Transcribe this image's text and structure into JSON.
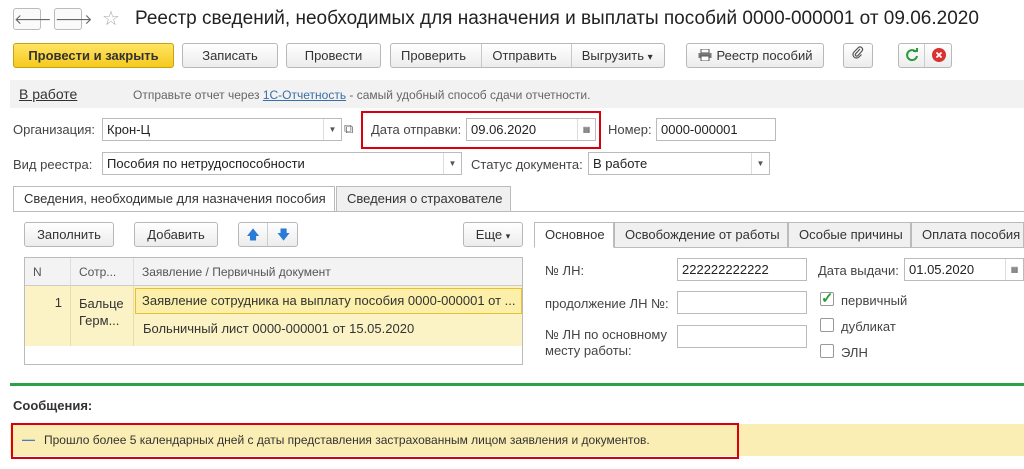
{
  "header": {
    "back": "🡐",
    "forward": "🡒",
    "star": "☆",
    "title": "Реестр сведений, необходимых для назначения и выплаты пособий 0000-000001 от 09.06.2020"
  },
  "toolbar": {
    "post_close": "Провести и закрыть",
    "save": "Записать",
    "post": "Провести",
    "check": "Проверить",
    "send": "Отправить",
    "export": "Выгрузить",
    "export_arrow": "▾",
    "registry": "Реестр пособий",
    "clip_icon": "paperclip-icon",
    "refresh_icon": "refresh-icon",
    "close_icon": "close-icon"
  },
  "status": {
    "state": "В работе",
    "message_prefix": "Отправьте отчет через ",
    "message_link": "1С-Отчетность",
    "message_suffix": " - самый удобный способ сдачи отчетности."
  },
  "form": {
    "org_label": "Организация:",
    "org_value": "Крон-Ц",
    "date_label": "Дата отправки:",
    "date_value": "09.06.2020",
    "number_label": "Номер:",
    "number_value": "0000-000001",
    "registry_label": "Вид реестра:",
    "registry_value": "Пособия по нетрудоспособности",
    "docstatus_label": "Статус документа:",
    "docstatus_value": "В работе"
  },
  "tabs": [
    "Сведения, необходимые для назначения пособия",
    "Сведения о страхователе"
  ],
  "left_toolbar": {
    "fill": "Заполнить",
    "add": "Добавить",
    "more": "Еще"
  },
  "table": {
    "headers": [
      "N",
      "Сотр...",
      "Заявление / Первичный документ"
    ],
    "row": {
      "n": "1",
      "employee": "Бальце Герм...",
      "doc1": "Заявление сотрудника на выплату пособия 0000-000001 от ...",
      "doc2": "Больничный лист 0000-000001 от 15.05.2020"
    }
  },
  "right_tabs": [
    "Основное",
    "Освобождение от работы",
    "Особые причины",
    "Оплата пособия"
  ],
  "details": {
    "ln_label": "№ ЛН:",
    "ln_value": "222222222222",
    "issue_label": "Дата выдачи:",
    "issue_value": "01.05.2020",
    "cont_label": "продолжение ЛН №:",
    "main_label_1": "№ ЛН по основному",
    "main_label_2": "месту работы:",
    "primary": "первичный",
    "duplicate": "дубликат",
    "eln": "ЭЛН",
    "primary_checked": true
  },
  "messages": {
    "title": "Сообщения:",
    "dash": "—",
    "text": "Прошло более 5 календарных дней с даты представления застрахованным лицом заявления и документов."
  }
}
